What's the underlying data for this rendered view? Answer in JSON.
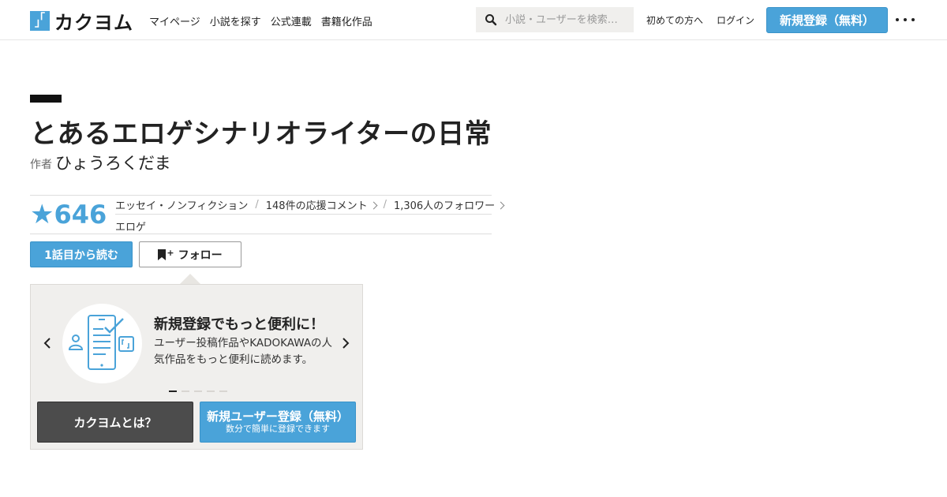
{
  "header": {
    "logo_mark_left": "「",
    "logo_mark_right": "」",
    "logo_text": "カクヨム",
    "nav": [
      "マイページ",
      "小説を探す",
      "公式連載",
      "書籍化作品"
    ],
    "search_placeholder": "小説・ユーザーを検索…",
    "first_time": "初めての方へ",
    "login": "ログイン",
    "signup": "新規登録（無料）",
    "icons": [
      "search-icon",
      "more-icon"
    ]
  },
  "work": {
    "title": "とあるエロゲシナリオライターの日常",
    "author_label": "作者",
    "author": "ひょうろくだま",
    "star_icon": "★",
    "stars": "646",
    "genre": "エッセイ・ノンフィクション",
    "comments": "148件の応援コメント",
    "followers": "1,306人のフォロワー",
    "tag": "エロゲ",
    "separator": "/"
  },
  "actions": {
    "read_first": "1話目から読む",
    "follow_plus": "+",
    "follow": "フォロー"
  },
  "promo": {
    "title": "新規登録でもっと便利に！",
    "body": "ユーザー投稿作品やKADOKAWAの人気作品をもっと便利に読めます。",
    "slides_total": 5,
    "active_slide": 1,
    "about": "カクヨムとは？",
    "register_main": "新規ユーザー登録（無料）",
    "register_sub": "数分で簡単に登録できます"
  },
  "colors": {
    "accent": "#4aa3d9",
    "dark_button": "#4c4c4c",
    "panel_bg": "#f0efed"
  }
}
